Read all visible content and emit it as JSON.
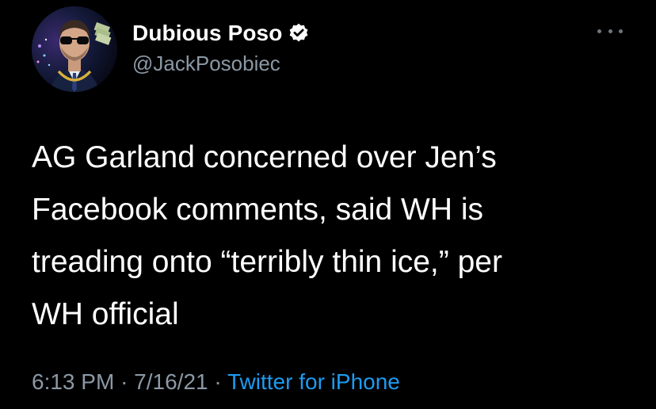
{
  "author": {
    "display_name": "Dubious Poso",
    "handle": "@JackPosobiec",
    "verified": true
  },
  "tweet": {
    "lines": [
      "AG Garland concerned over Jen’s",
      "Facebook comments, said WH is",
      "treading onto “terribly thin ice,” per",
      "WH official"
    ],
    "time": "6:13 PM",
    "separator": "·",
    "date": "7/16/21",
    "source": "Twitter for iPhone"
  },
  "icons": {
    "more": "more-horizontal-icon",
    "verified": "verified-badge-icon"
  },
  "colors": {
    "background": "#000000",
    "text": "#ffffff",
    "secondary": "#8b98a5",
    "accent": "#1d9bf0"
  }
}
